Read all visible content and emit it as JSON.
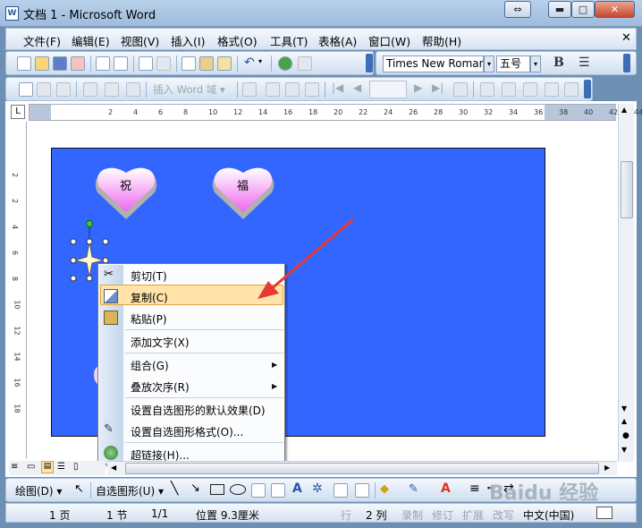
{
  "window": {
    "title": "文档 1 - Microsoft Word",
    "app_icon": "W"
  },
  "menubar": {
    "items": [
      "文件(F)",
      "编辑(E)",
      "视图(V)",
      "插入(I)",
      "格式(O)",
      "工具(T)",
      "表格(A)",
      "窗口(W)",
      "帮助(H)"
    ]
  },
  "toolbar": {
    "font_name": "Times New Roman",
    "font_size": "五号",
    "bold_label": "B",
    "insert_field_label": "插入 Word 域 ▾"
  },
  "ruler": {
    "ticks": [
      "8",
      "6",
      "4",
      "2",
      "2",
      "4",
      "6",
      "8",
      "10",
      "12",
      "14",
      "16",
      "18",
      "20",
      "22",
      "24",
      "26",
      "28",
      "30",
      "32",
      "34",
      "36",
      "38",
      "40",
      "42",
      "44"
    ]
  },
  "vruler": {
    "ticks": [
      "2",
      "2",
      "4",
      "6",
      "8",
      "10",
      "12",
      "14",
      "16",
      "18"
    ]
  },
  "shapes": {
    "hearts": [
      "祝",
      "福"
    ]
  },
  "context_menu": {
    "items": [
      {
        "label": "剪切(T)",
        "icon": "scissors-icon"
      },
      {
        "label": "复制(C)",
        "icon": "copy-icon",
        "highlighted": true
      },
      {
        "label": "粘贴(P)",
        "icon": "paste-icon"
      },
      {
        "label": "添加文字(X)"
      },
      {
        "label": "组合(G)",
        "submenu": true
      },
      {
        "label": "叠放次序(R)",
        "submenu": true
      },
      {
        "label": "设置自选图形的默认效果(D)"
      },
      {
        "label": "设置自选图形格式(O)...",
        "icon": "format-shape-icon"
      },
      {
        "label": "超链接(H)...",
        "icon": "hyperlink-icon"
      }
    ]
  },
  "drawbar": {
    "draw_label": "绘图(D) ▾",
    "autoshape_label": "自选图形(U) ▾"
  },
  "status": {
    "page": "1 页",
    "section": "1 节",
    "pages": "1/1",
    "position": "位置 9.3厘米",
    "line": "行",
    "col": "2 列",
    "rec": "录制",
    "rev": "修订",
    "ext": "扩展",
    "ovr": "改写",
    "lang": "中文(中国)"
  },
  "watermark": "Baidu 经验",
  "colors": {
    "accent_blue": "#3366ff",
    "highlight": "#ffe3a8",
    "arrow": "#e53935"
  }
}
